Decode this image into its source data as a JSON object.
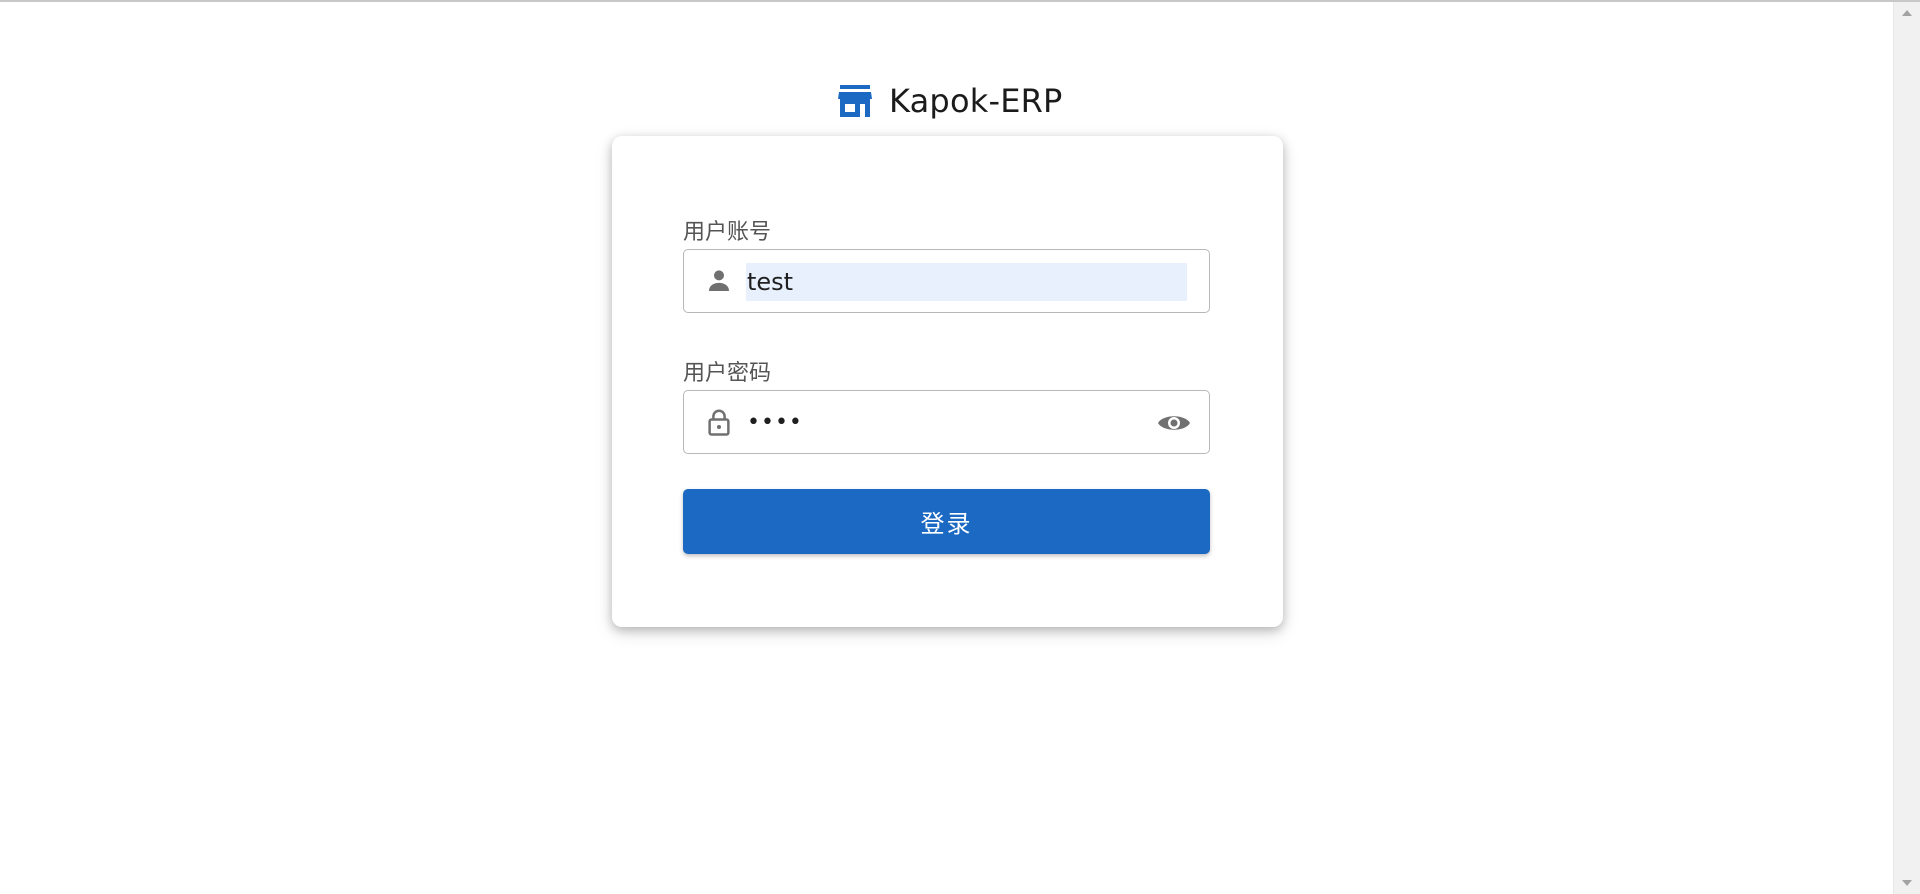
{
  "app": {
    "title": "Kapok-ERP",
    "brand_icon": "store-icon",
    "accent_color": "#1b69c2"
  },
  "login_form": {
    "username": {
      "label": "用户账号",
      "value": "test",
      "icon": "person-icon"
    },
    "password": {
      "label": "用户密码",
      "masked_value": "••••",
      "icon": "lock-icon",
      "toggle_icon": "eye-icon"
    },
    "submit_label": "登录"
  }
}
